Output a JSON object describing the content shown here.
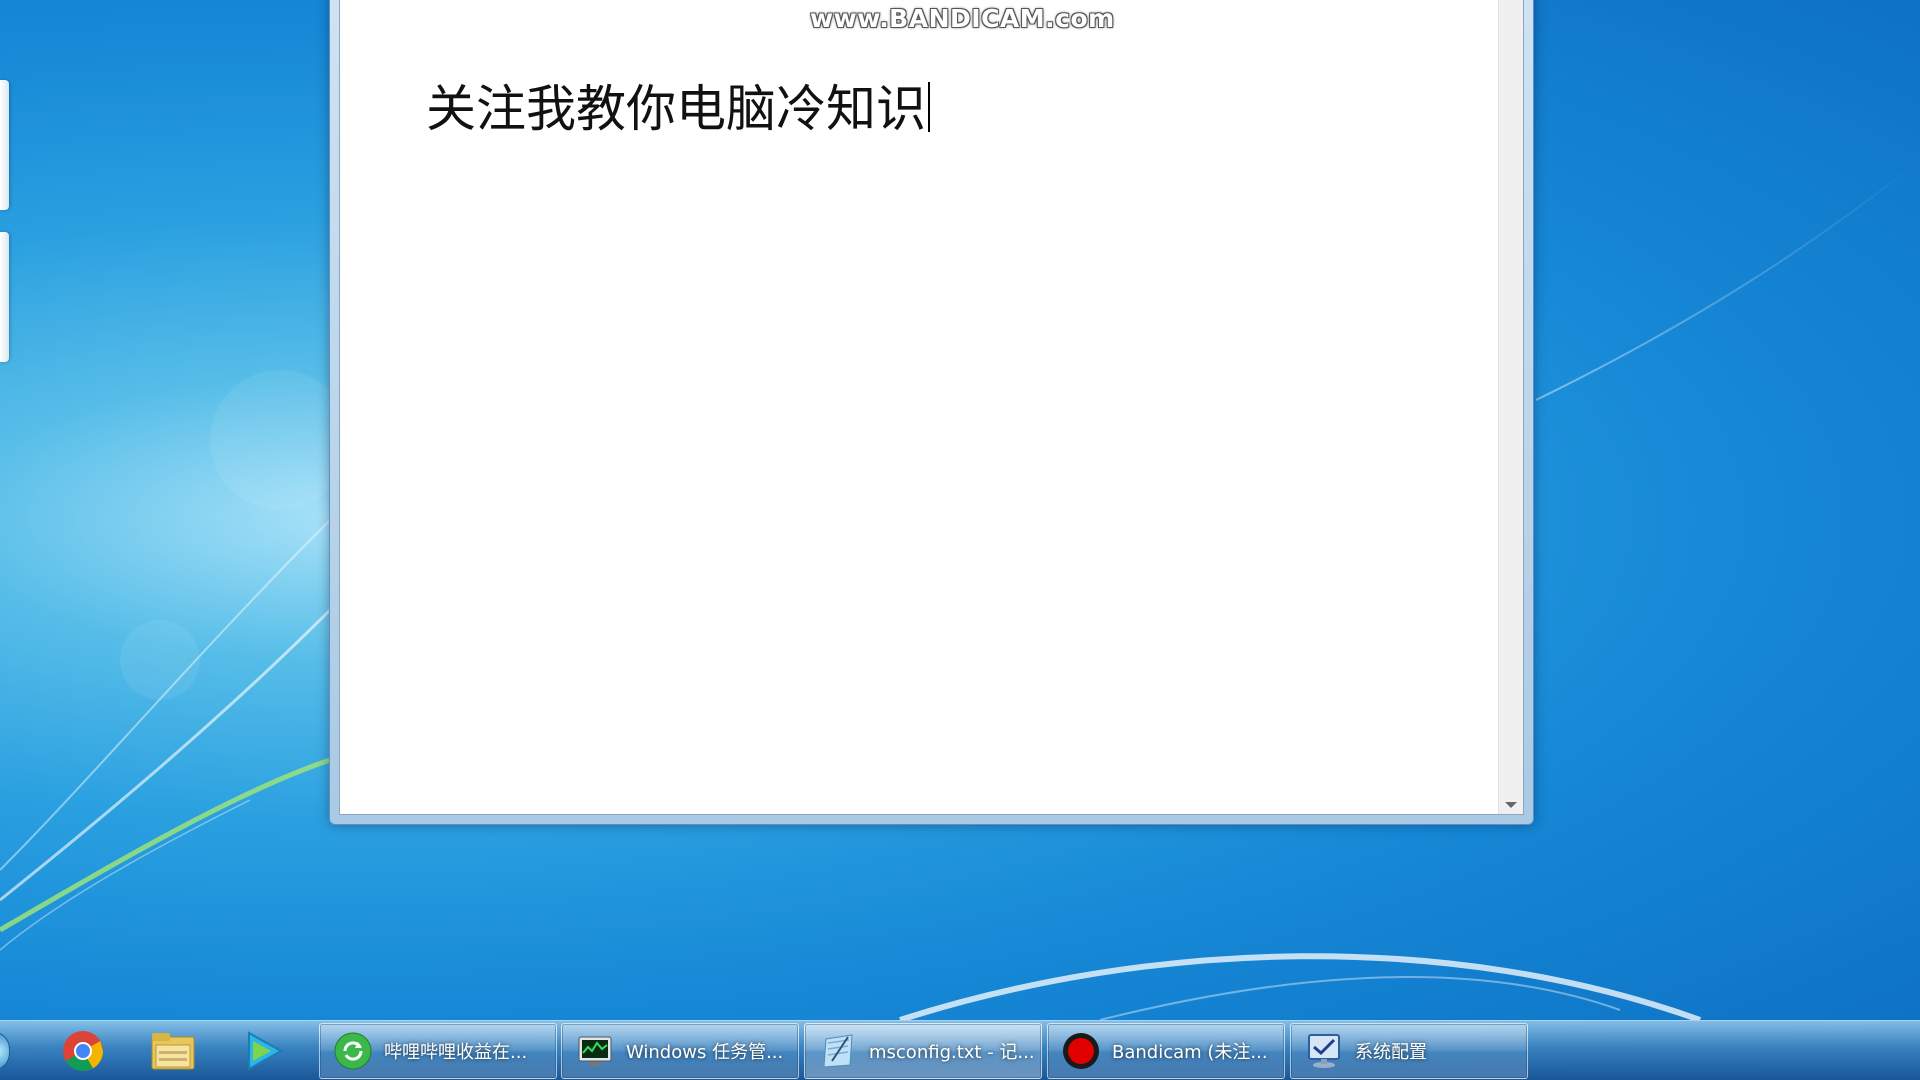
{
  "watermark": "www.BANDICAM.com",
  "notepad": {
    "content": "关注我教你电脑冷知识"
  },
  "taskbar": {
    "pinned": [
      {
        "name": "chrome-icon"
      },
      {
        "name": "folder-icon"
      },
      {
        "name": "media-player-icon"
      }
    ],
    "tasks": [
      {
        "label": "哔哩哔哩收益在...",
        "icon": "green-refresh-icon"
      },
      {
        "label": "Windows 任务管...",
        "icon": "task-manager-icon"
      },
      {
        "label": "msconfig.txt - 记...",
        "icon": "notepad-icon"
      },
      {
        "label": "Bandicam (未注...",
        "icon": "record-icon"
      },
      {
        "label": "系统配置",
        "icon": "system-config-icon"
      }
    ]
  },
  "colors": {
    "desktop": "#1688d6",
    "record": "#e00000"
  }
}
